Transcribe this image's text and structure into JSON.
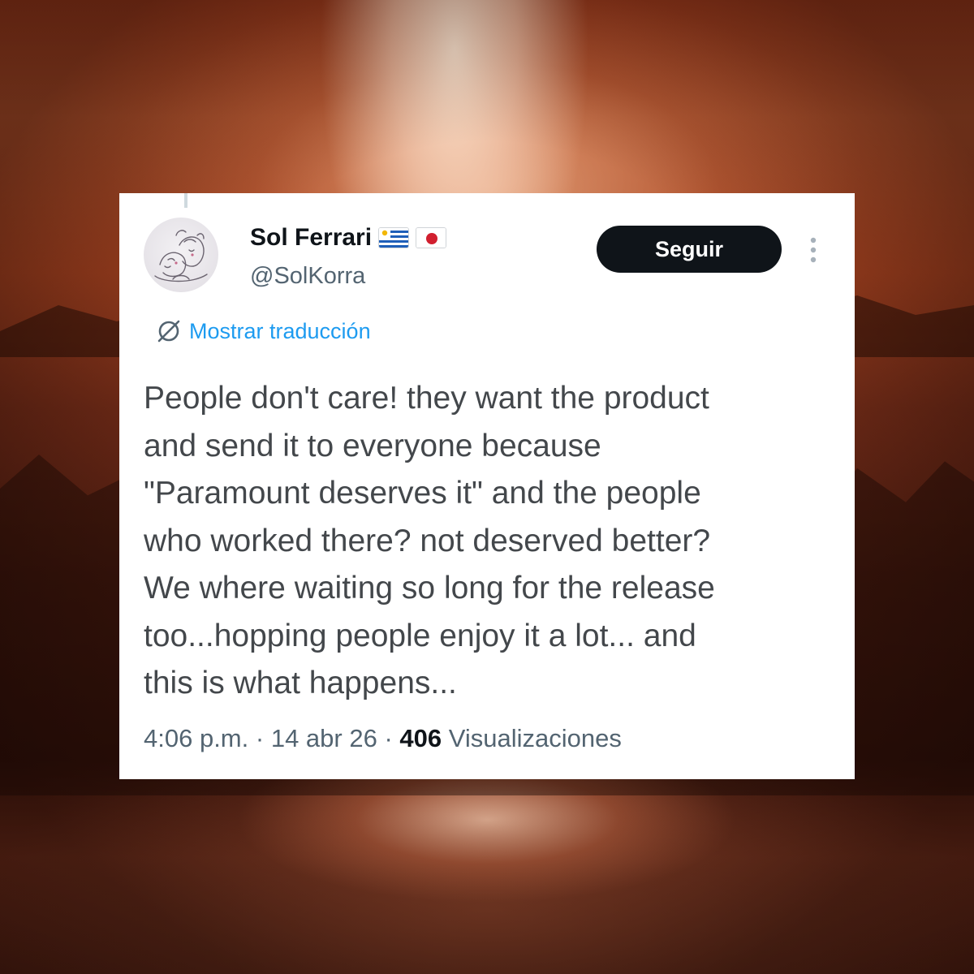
{
  "tweet": {
    "author": {
      "display_name": "Sol Ferrari",
      "flags": [
        "uruguay-flag-icon",
        "japan-flag-icon"
      ],
      "handle": "@SolKorra"
    },
    "follow_label": "Seguir",
    "more_icon": "more-vertical-icon",
    "translate": {
      "icon": "globe-slash-icon",
      "label": "Mostrar traducción"
    },
    "text": "People don't care! they want the product\nand send it to everyone because\n\"Paramount deserves it\" and the people\nwho worked there? not deserved better?\nWe where waiting so long for the release\ntoo...hopping people enjoy it a lot... and\nthis is what happens...",
    "meta": {
      "time": "4:06 p.m.",
      "separator": "·",
      "date": "14 abr 26",
      "views_count": "406",
      "views_label": "Visualizaciones"
    }
  },
  "colors": {
    "accent": "#1d9bf0",
    "text": "#0f1419",
    "secondary": "#536471",
    "button": "#0f1419"
  }
}
